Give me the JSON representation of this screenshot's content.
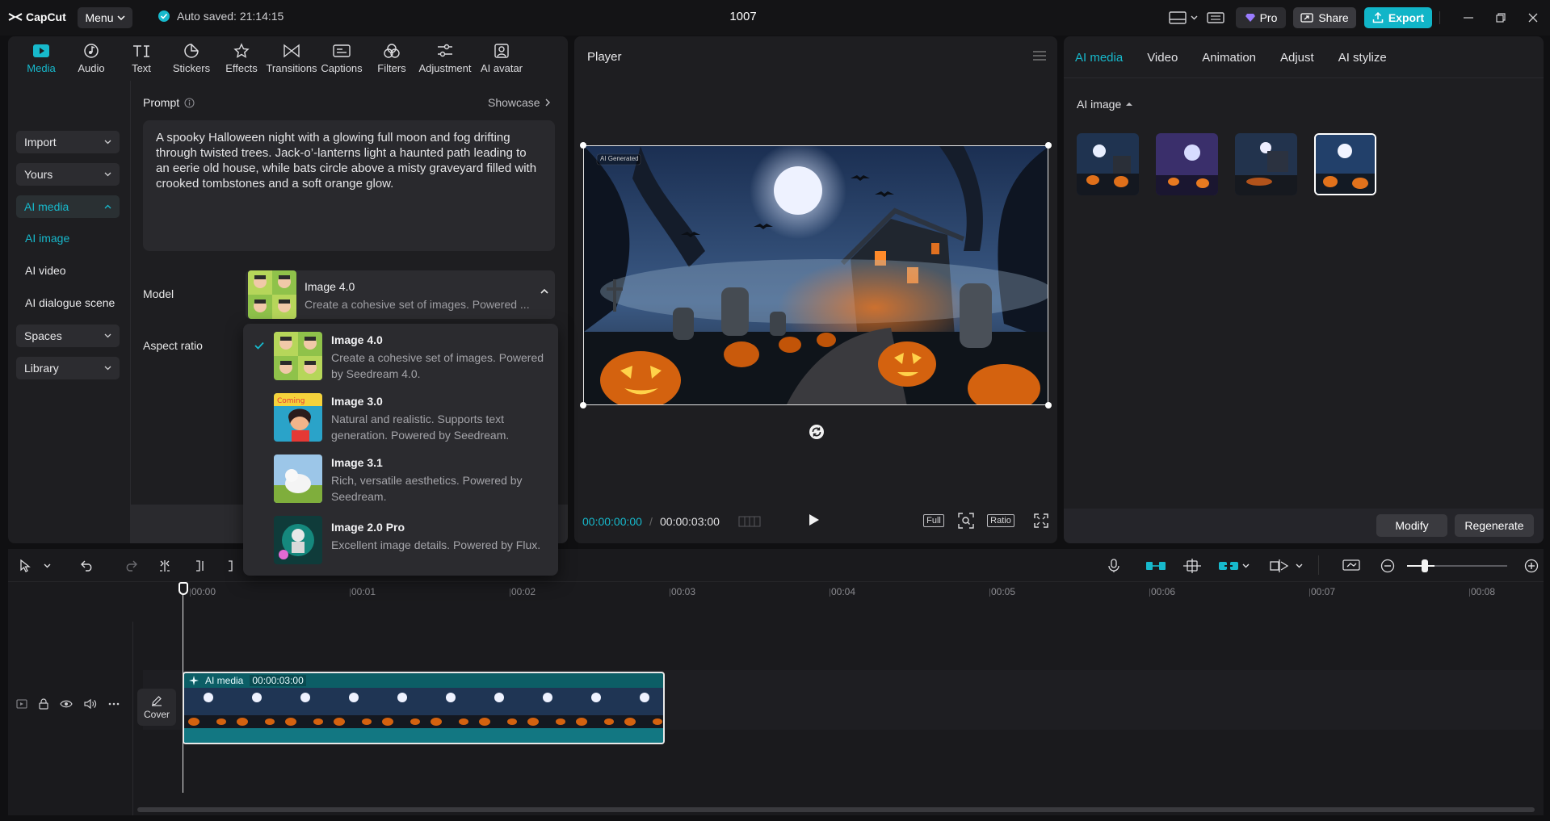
{
  "titlebar": {
    "logo": "CapCut",
    "menu": "Menu",
    "autosave": "Auto saved: 21:14:15",
    "project_title": "1007",
    "pro": "Pro",
    "share": "Share",
    "export": "Export"
  },
  "toolbar": [
    {
      "label": "Media",
      "icon": "media-icon"
    },
    {
      "label": "Audio",
      "icon": "audio-icon"
    },
    {
      "label": "Text",
      "icon": "text-icon"
    },
    {
      "label": "Stickers",
      "icon": "stickers-icon"
    },
    {
      "label": "Effects",
      "icon": "effects-icon"
    },
    {
      "label": "Transitions",
      "icon": "transitions-icon"
    },
    {
      "label": "Captions",
      "icon": "captions-icon"
    },
    {
      "label": "Filters",
      "icon": "filters-icon"
    },
    {
      "label": "Adjustment",
      "icon": "adjustment-icon"
    },
    {
      "label": "AI avatar",
      "icon": "ai-avatar-icon"
    }
  ],
  "sidenav": {
    "import": "Import",
    "yours": "Yours",
    "ai_media": "AI media",
    "ai_image": "AI image",
    "ai_video": "AI video",
    "ai_dialogue": "AI dialogue scene",
    "spaces": "Spaces",
    "library": "Library"
  },
  "prompt": {
    "label": "Prompt",
    "showcase": "Showcase",
    "text": "A spooky Halloween night with a glowing full moon and fog drifting through twisted trees. Jack-o’-lanterns light a haunted path leading to an eerie old house, while bats circle above a misty graveyard filled with crooked tombstones and a soft orange glow."
  },
  "model": {
    "label": "Model",
    "selected_name": "Image 4.0",
    "selected_desc": "Create a cohesive set of images. Powered ...",
    "aspect_label": "Aspect ratio"
  },
  "dropdown": [
    {
      "name": "Image 4.0",
      "desc": "Create a cohesive set of images. Powered by Seedream 4.0."
    },
    {
      "name": "Image 3.0",
      "desc": "Natural and realistic. Supports text generation. Powered by Seedream."
    },
    {
      "name": "Image 3.1",
      "desc": "Rich, versatile aesthetics. Powered by Seedream."
    },
    {
      "name": "Image 2.0 Pro",
      "desc": "Excellent image details. Powered by Flux."
    }
  ],
  "player": {
    "title": "Player",
    "badge": "AI Generated",
    "current_time": "00:00:00:00",
    "separator": "/",
    "total_time": "00:00:03:00",
    "full": "Full",
    "ratio": "Ratio"
  },
  "right_panel": {
    "tabs": [
      "AI media",
      "Video",
      "Animation",
      "Adjust",
      "AI stylize"
    ],
    "section": "AI image",
    "modify": "Modify",
    "regenerate": "Regenerate"
  },
  "timeline": {
    "ticks": [
      "00:00",
      "00:01",
      "00:02",
      "00:03",
      "00:04",
      "00:05",
      "00:06",
      "00:07",
      "00:08"
    ],
    "cover": "Cover",
    "clip_label": "AI media",
    "clip_duration": "00:00:03:00"
  },
  "colors": {
    "accent": "#17b9cc",
    "export": "#11b5c8",
    "panel": "#1e1e21",
    "clip": "#0c5e66"
  }
}
